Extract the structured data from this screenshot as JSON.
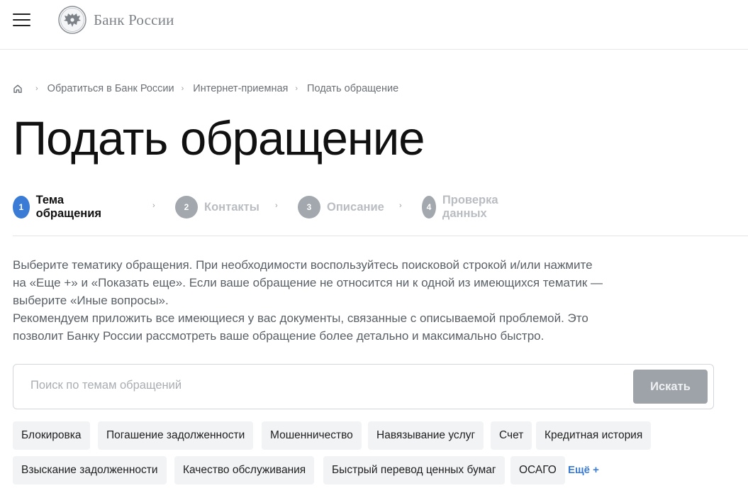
{
  "header": {
    "logo_text": "Банк России",
    "menu_icon": "hamburger-menu-icon",
    "emblem_icon": "double-headed-eagle-icon"
  },
  "breadcrumb": {
    "home_icon": "home-icon",
    "items": [
      "Обратиться в Банк России",
      "Интернет-приемная",
      "Подать обращение"
    ]
  },
  "page": {
    "title": "Подать обращение"
  },
  "steps": [
    {
      "number": "1",
      "label": "Тема обращения",
      "state": "active"
    },
    {
      "number": "2",
      "label": "Контакты",
      "state": "inactive"
    },
    {
      "number": "3",
      "label": "Описание",
      "state": "inactive"
    },
    {
      "number": "4",
      "label": "Проверка данных",
      "state": "inactive"
    }
  ],
  "intro": {
    "line1": "Выберите тематику обращения. При необходимости воспользуйтесь поисковой строкой и/или нажмите",
    "line2": "на «Еще +» и «Показать еще». Если ваше обращение не относится ни к одной из имеющихся тематик —",
    "line3": "выберите «Иные вопросы».",
    "line4": "Рекомендуем приложить все имеющиеся у вас документы, связанные с описываемой проблемой. Это",
    "line5": "позволит Банку России рассмотреть ваше обращение более детально и максимально быстро."
  },
  "search": {
    "value": "",
    "placeholder": "Поиск по темам обращений",
    "button_label": "Искать"
  },
  "topics": {
    "row1": [
      "Блокировка",
      "Погашение задолженности",
      "Мошенничество",
      "Навязывание услуг",
      "Счет",
      "Кредитная история"
    ],
    "row2": [
      "Взыскание задолженности",
      "Качество обслуживания",
      "Быстрый перевод ценных бумаг",
      "ОСАГО"
    ],
    "more_label": "Ещё +"
  },
  "colors": {
    "accent": "#3a7bd5",
    "inactive_step": "#a3a8ae",
    "chip_bg": "#f2f3f5",
    "search_button": "#9ea3a9"
  }
}
